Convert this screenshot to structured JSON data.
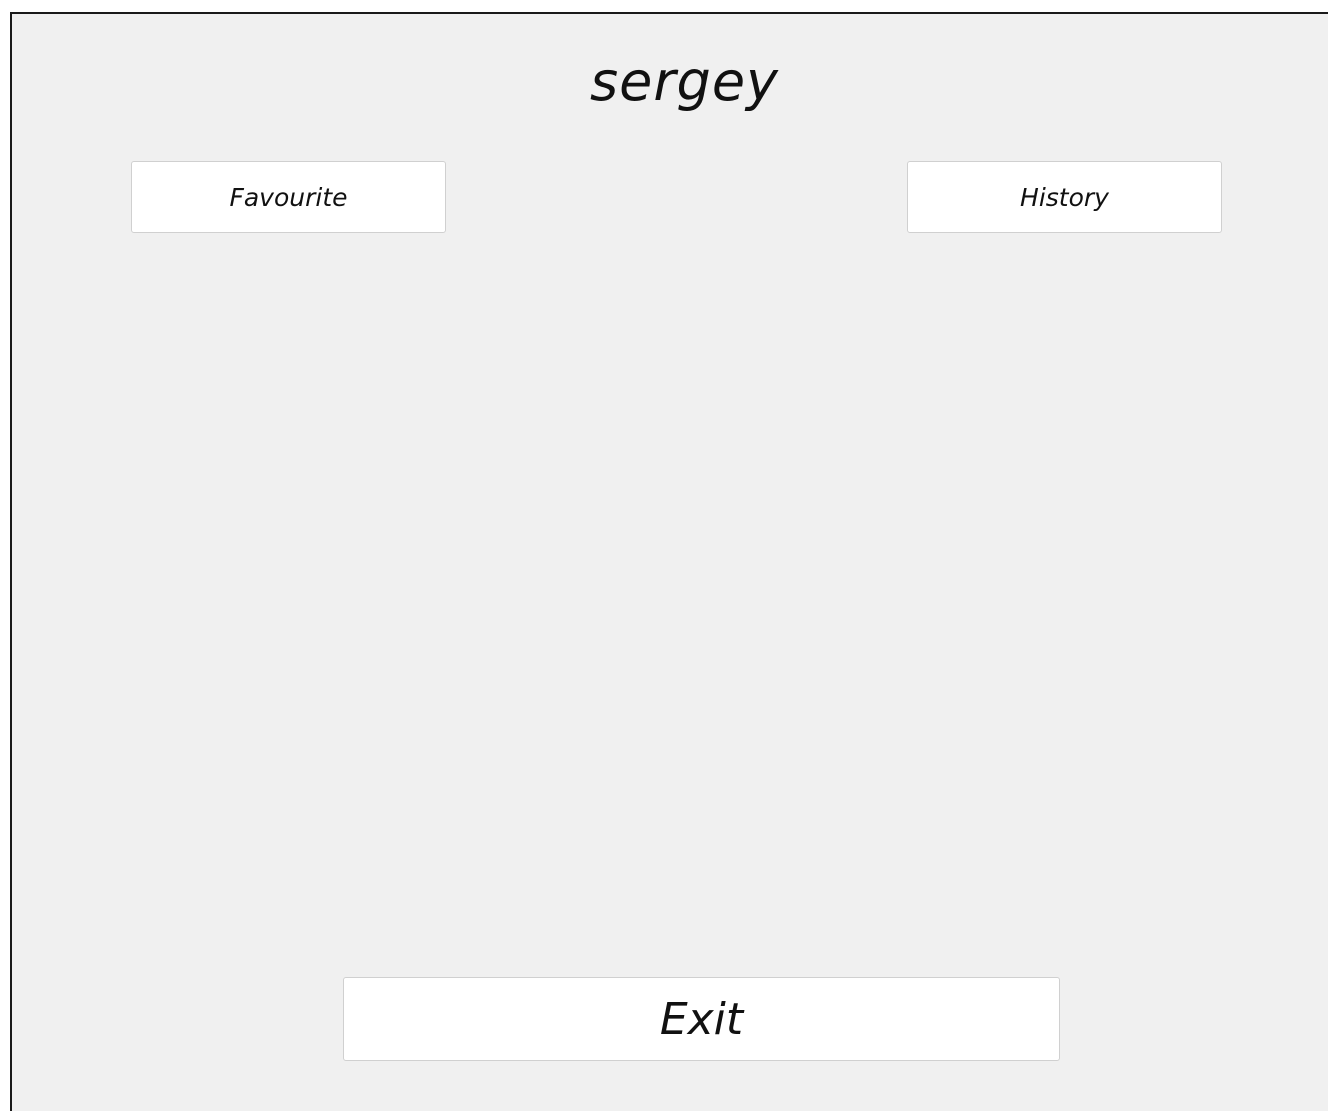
{
  "header": {
    "username": "sergey"
  },
  "buttons": {
    "favourite_label": "Favourite",
    "history_label": "History",
    "exit_label": "Exit"
  },
  "colors": {
    "window_background": "#f0f0f0",
    "button_background": "#ffffff",
    "text": "#111111"
  }
}
